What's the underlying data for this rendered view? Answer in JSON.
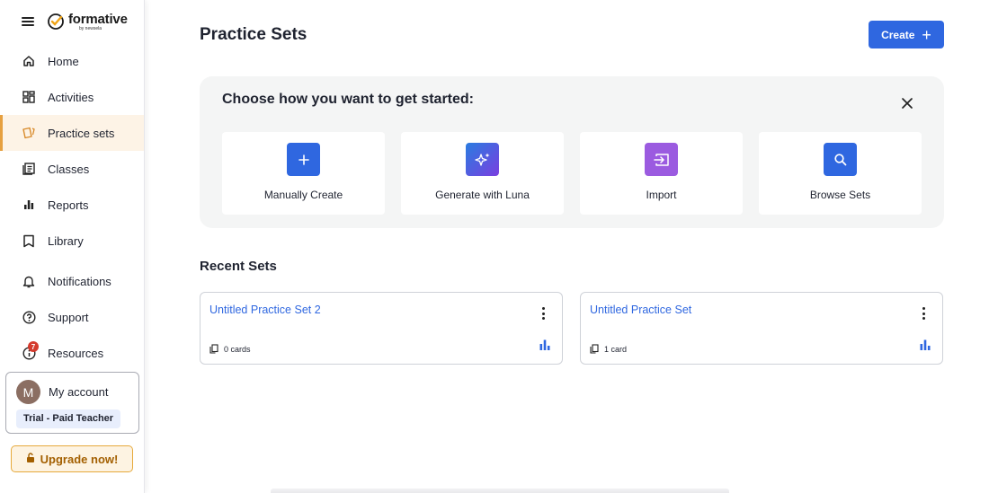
{
  "app": {
    "brand_name": "formative",
    "brand_sub": "by newsela",
    "accent_color": "#2f67e0",
    "active_color": "#e6a040"
  },
  "sidebar": {
    "items": [
      {
        "label": "Home",
        "icon": "home-icon"
      },
      {
        "label": "Activities",
        "icon": "grid-icon"
      },
      {
        "label": "Practice sets",
        "icon": "cards-icon",
        "active": true
      },
      {
        "label": "Classes",
        "icon": "roster-icon"
      },
      {
        "label": "Reports",
        "icon": "bar-chart-icon"
      },
      {
        "label": "Library",
        "icon": "bookmark-icon"
      },
      {
        "label": "Notifications",
        "icon": "bell-icon"
      },
      {
        "label": "Support",
        "icon": "help-icon"
      },
      {
        "label": "Resources",
        "icon": "info-icon",
        "badge": "7"
      }
    ],
    "account": {
      "avatar_letter": "M",
      "label": "My account",
      "plan": "Trial - Paid Teacher"
    },
    "upgrade_label": "Upgrade now!"
  },
  "main": {
    "title": "Practice Sets",
    "create_label": "Create",
    "starter": {
      "title": "Choose how you want to get started:",
      "options": [
        {
          "label": "Manually Create",
          "icon": "plus-icon",
          "color": "#2f67e0"
        },
        {
          "label": "Generate with Luna",
          "icon": "sparkle-icon",
          "color": "#6a4be0"
        },
        {
          "label": "Import",
          "icon": "import-icon",
          "color": "#9b5be0"
        },
        {
          "label": "Browse Sets",
          "icon": "search-icon",
          "color": "#2f67e0"
        }
      ]
    },
    "recent": {
      "title": "Recent Sets",
      "sets": [
        {
          "name": "Untitled Practice Set 2",
          "count": "0 cards"
        },
        {
          "name": "Untitled Practice Set",
          "count": "1 card"
        }
      ]
    }
  }
}
